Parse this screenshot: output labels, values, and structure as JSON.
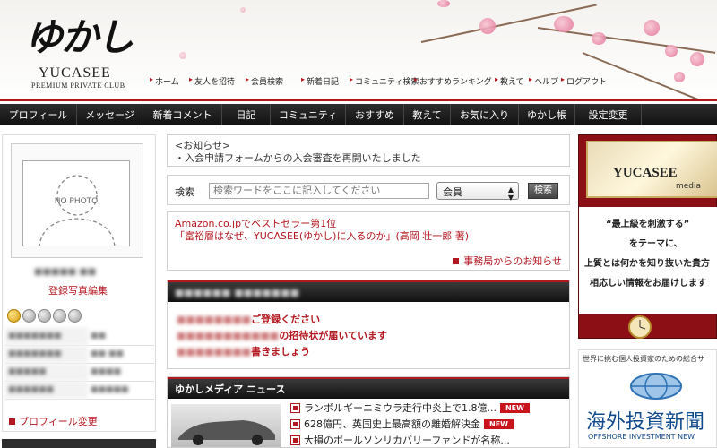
{
  "header": {
    "logo_mark": "ゆかし",
    "logo_text": "YUCASEE",
    "logo_sub": "PREMIUM PRIVATE CLUB",
    "nav": [
      "ホーム",
      "友人を招待",
      "会員検索",
      "新着日記",
      "コミュニティ検索",
      "おすすめランキング",
      "教えて",
      "ヘルプ",
      "ログアウト"
    ]
  },
  "main_nav": [
    "プロフィール",
    "メッセージ",
    "新着コメント",
    "日記",
    "コミュニティ",
    "おすすめ",
    "教えて",
    "お気に入り",
    "ゆかし帳",
    "設定変更"
  ],
  "profile": {
    "no_photo": "NO PHOTO",
    "name_blurred": "■■■■■ ■■",
    "edit_photo": "登録写真編集",
    "stats": [
      {
        "label": "■■■■■■■",
        "value": "■■"
      },
      {
        "label": "■■■■■■■",
        "value": "■■ ■■"
      },
      {
        "label": "■■■■■",
        "value": "■■■■"
      },
      {
        "label": "■■■■■■",
        "value": "■■■■■"
      }
    ],
    "edit_profile": "プロフィール変更"
  },
  "notice": {
    "title": "<お知らせ>",
    "body": "・入会申請フォームからの入会審査を再開いたしました"
  },
  "search": {
    "label": "検索",
    "placeholder": "検索ワードをここに記入してください",
    "select_value": "会員",
    "button": "検索"
  },
  "promo": {
    "line1": "Amazon.co.jpでベストセラー第1位",
    "line2": "「富裕層はなぜ、YUCASEE(ゆかし)に入るのか」(高岡 壮一郎 著)",
    "office_link": "事務局からのお知らせ"
  },
  "welcome": {
    "bar_title_blurred": "■■■■■■ ■■■■■■■",
    "lines": [
      {
        "blurred": "■■■■■■■■",
        "text": "ご登録ください"
      },
      {
        "blurred": "■■■■■■■■■■■",
        "text": "の招待状が届いています"
      },
      {
        "blurred": "■■■■■■■■",
        "text": "書きましょう"
      }
    ]
  },
  "media_news": {
    "title": "ゆかしメディア ニュース",
    "new_label": "NEW",
    "items": [
      {
        "text": "ランボルギーニミウラ走行中炎上で1.8億...",
        "is_new": true
      },
      {
        "text": "628億円、英国史上最高額の離婚解決金",
        "is_new": true
      },
      {
        "text": "大損のポールソンリカバリーファンドが名称...",
        "is_new": false
      }
    ]
  },
  "right_ad": {
    "brand": "YUCASEE",
    "brand_sub": "media",
    "quote1": "“最上級を刺激する”",
    "quote2": "をテーマに、",
    "quote3": "上質とは何かを知り抜いた貴方",
    "quote4": "相応しい情報をお届けします",
    "second_caption": "世界に挑む個人投資家のための総合サ",
    "second_title": "海外投資新聞",
    "second_sub": "OFFSHORE INVESTMENT NEW"
  },
  "colors": {
    "accent": "#b3171f",
    "nav_bg": "#1a1a1a",
    "ad_red": "#8c0f15"
  }
}
